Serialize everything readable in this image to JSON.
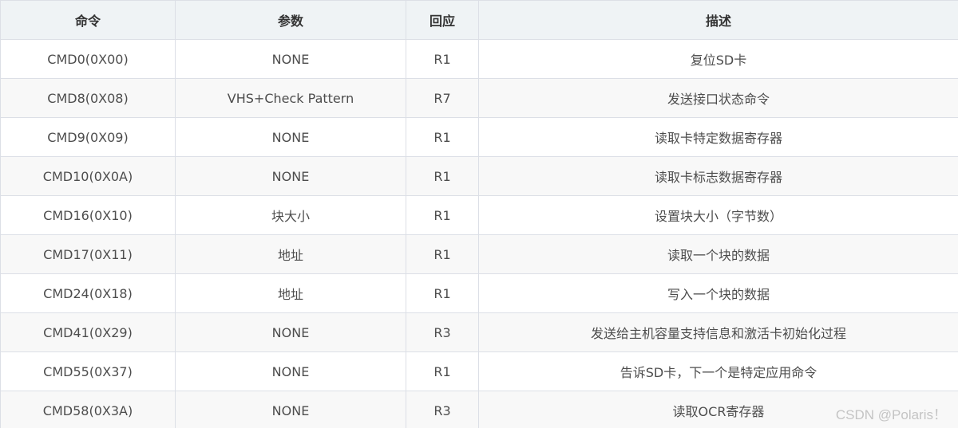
{
  "table": {
    "headers": [
      "命令",
      "参数",
      "回应",
      "描述"
    ],
    "rows": [
      [
        "CMD0(0X00)",
        "NONE",
        "R1",
        "复位SD卡"
      ],
      [
        "CMD8(0X08)",
        "VHS+Check Pattern",
        "R7",
        "发送接口状态命令"
      ],
      [
        "CMD9(0X09)",
        "NONE",
        "R1",
        "读取卡特定数据寄存器"
      ],
      [
        "CMD10(0X0A)",
        "NONE",
        "R1",
        "读取卡标志数据寄存器"
      ],
      [
        "CMD16(0X10)",
        "块大小",
        "R1",
        "设置块大小（字节数）"
      ],
      [
        "CMD17(0X11)",
        "地址",
        "R1",
        "读取一个块的数据"
      ],
      [
        "CMD24(0X18)",
        "地址",
        "R1",
        "写入一个块的数据"
      ],
      [
        "CMD41(0X29)",
        "NONE",
        "R3",
        "发送给主机容量支持信息和激活卡初始化过程"
      ],
      [
        "CMD55(0X37)",
        "NONE",
        "R1",
        "告诉SD卡，下一个是特定应用命令"
      ],
      [
        "CMD58(0X3A)",
        "NONE",
        "R3",
        "读取OCR寄存器"
      ]
    ]
  },
  "watermark": "CSDN @Polaris！"
}
